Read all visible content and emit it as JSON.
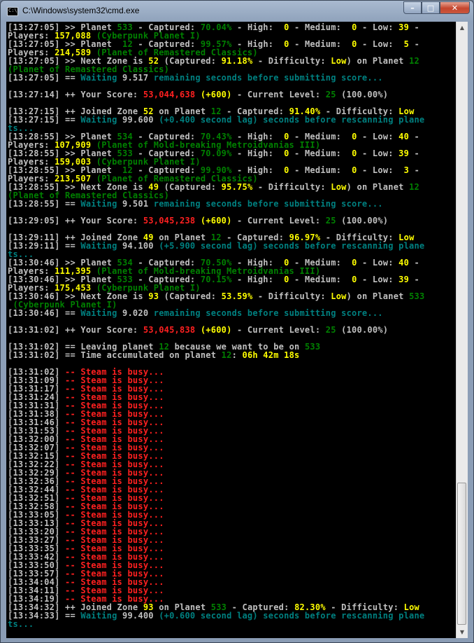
{
  "window": {
    "title": "C:\\Windows\\system32\\cmd.exe",
    "icon_text": "C:\\"
  },
  "controls": {
    "minimize": "–",
    "maximize": "□",
    "close": "✕"
  },
  "icons": {
    "scroll_up": "▲",
    "scroll_down": "▼"
  },
  "colors": {
    "white": "#c0c0c0",
    "yellow": "#ffff00",
    "green": "#008000",
    "cyan": "#008080",
    "red": "#ff2020"
  },
  "console_lines": [
    [
      [
        "w",
        "[13:27:05] >> Planet "
      ],
      [
        "g",
        "533"
      ],
      [
        "w",
        " - Captured: "
      ],
      [
        "g",
        "70.04%"
      ],
      [
        "w",
        " - High:  "
      ],
      [
        "y",
        "0"
      ],
      [
        "w",
        " - Medium:  "
      ],
      [
        "y",
        "0"
      ],
      [
        "w",
        " - Low: "
      ],
      [
        "y",
        "39"
      ],
      [
        "w",
        " -"
      ]
    ],
    [
      [
        "w",
        "Players: "
      ],
      [
        "y",
        "157,088"
      ],
      [
        "g",
        " (Cyberpunk Planet I)"
      ]
    ],
    [
      [
        "w",
        "[13:27:05] >> Planet  "
      ],
      [
        "g",
        "12"
      ],
      [
        "w",
        " - Captured: "
      ],
      [
        "g",
        "99.57%"
      ],
      [
        "w",
        " - High:  "
      ],
      [
        "y",
        "0"
      ],
      [
        "w",
        " - Medium:  "
      ],
      [
        "y",
        "0"
      ],
      [
        "w",
        " - Low:  "
      ],
      [
        "y",
        "5"
      ],
      [
        "w",
        " -"
      ]
    ],
    [
      [
        "w",
        "Players: "
      ],
      [
        "y",
        "214,589"
      ],
      [
        "g",
        " (Planet of Remastered Classics)"
      ]
    ],
    [
      [
        "w",
        "[13:27:05] >> Next Zone is "
      ],
      [
        "y",
        "52"
      ],
      [
        "w",
        " (Captured: "
      ],
      [
        "y",
        "91.18%"
      ],
      [
        "w",
        " - Difficulty: "
      ],
      [
        "y",
        "Low"
      ],
      [
        "w",
        ") on Planet "
      ],
      [
        "g",
        "12"
      ]
    ],
    [
      [
        "g",
        "(Planet of Remastered Classics)"
      ]
    ],
    [
      [
        "w",
        "[13:27:05] == "
      ],
      [
        "c",
        "Waiting "
      ],
      [
        "w",
        "9.517"
      ],
      [
        "c",
        " remaining seconds before submitting score..."
      ]
    ],
    [
      [
        "w",
        ""
      ]
    ],
    [
      [
        "w",
        "[13:27:14] ++ Your Score: "
      ],
      [
        "r",
        "53,044,638"
      ],
      [
        "y",
        " (+600)"
      ],
      [
        "w",
        " - Current Level: "
      ],
      [
        "g",
        "25"
      ],
      [
        "w",
        " (100.00%)"
      ]
    ],
    [
      [
        "w",
        ""
      ]
    ],
    [
      [
        "w",
        "[13:27:15] ++ Joined Zone "
      ],
      [
        "y",
        "52"
      ],
      [
        "w",
        " on Planet "
      ],
      [
        "g",
        "12"
      ],
      [
        "w",
        " - Captured: "
      ],
      [
        "y",
        "91.40%"
      ],
      [
        "w",
        " - Difficulty: "
      ],
      [
        "y",
        "Low"
      ]
    ],
    [
      [
        "w",
        "[13:27:15] == "
      ],
      [
        "c",
        "Waiting "
      ],
      [
        "w",
        "99.600"
      ],
      [
        "c",
        " (+0.400 second lag) seconds before rescanning plane"
      ]
    ],
    [
      [
        "c",
        "ts..."
      ]
    ],
    [
      [
        "w",
        "[13:28:55] >> Planet "
      ],
      [
        "g",
        "534"
      ],
      [
        "w",
        " - Captured: "
      ],
      [
        "g",
        "70.43%"
      ],
      [
        "w",
        " - High:  "
      ],
      [
        "y",
        "0"
      ],
      [
        "w",
        " - Medium:  "
      ],
      [
        "y",
        "0"
      ],
      [
        "w",
        " - Low: "
      ],
      [
        "y",
        "40"
      ],
      [
        "w",
        " -"
      ]
    ],
    [
      [
        "w",
        "Players: "
      ],
      [
        "y",
        "107,909"
      ],
      [
        "g",
        " (Planet of Mold-breaking Metroidvanias III)"
      ]
    ],
    [
      [
        "w",
        "[13:28:55] >> Planet "
      ],
      [
        "g",
        "533"
      ],
      [
        "w",
        " - Captured: "
      ],
      [
        "g",
        "70.09%"
      ],
      [
        "w",
        " - High:  "
      ],
      [
        "y",
        "0"
      ],
      [
        "w",
        " - Medium:  "
      ],
      [
        "y",
        "0"
      ],
      [
        "w",
        " - Low: "
      ],
      [
        "y",
        "39"
      ],
      [
        "w",
        " -"
      ]
    ],
    [
      [
        "w",
        "Players: "
      ],
      [
        "y",
        "159,003"
      ],
      [
        "g",
        " (Cyberpunk Planet I)"
      ]
    ],
    [
      [
        "w",
        "[13:28:55] >> Planet  "
      ],
      [
        "g",
        "12"
      ],
      [
        "w",
        " - Captured: "
      ],
      [
        "g",
        "99.90%"
      ],
      [
        "w",
        " - High:  "
      ],
      [
        "y",
        "0"
      ],
      [
        "w",
        " - Medium:  "
      ],
      [
        "y",
        "0"
      ],
      [
        "w",
        " - Low:  "
      ],
      [
        "y",
        "3"
      ],
      [
        "w",
        " -"
      ]
    ],
    [
      [
        "w",
        "Players: "
      ],
      [
        "y",
        "213,507"
      ],
      [
        "g",
        " (Planet of Remastered Classics)"
      ]
    ],
    [
      [
        "w",
        "[13:28:55] >> Next Zone is "
      ],
      [
        "y",
        "49"
      ],
      [
        "w",
        " (Captured: "
      ],
      [
        "y",
        "95.75%"
      ],
      [
        "w",
        " - Difficulty: "
      ],
      [
        "y",
        "Low"
      ],
      [
        "w",
        ") on Planet "
      ],
      [
        "g",
        "12"
      ]
    ],
    [
      [
        "g",
        "(Planet of Remastered Classics)"
      ]
    ],
    [
      [
        "w",
        "[13:28:55] == "
      ],
      [
        "c",
        "Waiting "
      ],
      [
        "w",
        "9.501"
      ],
      [
        "c",
        " remaining seconds before submitting score..."
      ]
    ],
    [
      [
        "w",
        ""
      ]
    ],
    [
      [
        "w",
        "[13:29:05] ++ Your Score: "
      ],
      [
        "r",
        "53,045,238"
      ],
      [
        "y",
        " (+600)"
      ],
      [
        "w",
        " - Current Level: "
      ],
      [
        "g",
        "25"
      ],
      [
        "w",
        " (100.00%)"
      ]
    ],
    [
      [
        "w",
        ""
      ]
    ],
    [
      [
        "w",
        "[13:29:11] ++ Joined Zone "
      ],
      [
        "y",
        "49"
      ],
      [
        "w",
        " on Planet "
      ],
      [
        "g",
        "12"
      ],
      [
        "w",
        " - Captured: "
      ],
      [
        "y",
        "96.97%"
      ],
      [
        "w",
        " - Difficulty: "
      ],
      [
        "y",
        "Low"
      ]
    ],
    [
      [
        "w",
        "[13:29:11] == "
      ],
      [
        "c",
        "Waiting "
      ],
      [
        "w",
        "94.100"
      ],
      [
        "c",
        " (+5.900 second lag) seconds before rescanning plane"
      ]
    ],
    [
      [
        "c",
        "ts..."
      ]
    ],
    [
      [
        "w",
        "[13:30:46] >> Planet "
      ],
      [
        "g",
        "534"
      ],
      [
        "w",
        " - Captured: "
      ],
      [
        "g",
        "70.50%"
      ],
      [
        "w",
        " - High:  "
      ],
      [
        "y",
        "0"
      ],
      [
        "w",
        " - Medium:  "
      ],
      [
        "y",
        "0"
      ],
      [
        "w",
        " - Low: "
      ],
      [
        "y",
        "40"
      ],
      [
        "w",
        " -"
      ]
    ],
    [
      [
        "w",
        "Players: "
      ],
      [
        "y",
        "111,395"
      ],
      [
        "g",
        " (Planet of Mold-breaking Metroidvanias III)"
      ]
    ],
    [
      [
        "w",
        "[13:30:46] >> Planet "
      ],
      [
        "g",
        "533"
      ],
      [
        "w",
        " - Captured: "
      ],
      [
        "g",
        "70.15%"
      ],
      [
        "w",
        " - High:  "
      ],
      [
        "y",
        "0"
      ],
      [
        "w",
        " - Medium:  "
      ],
      [
        "y",
        "0"
      ],
      [
        "w",
        " - Low: "
      ],
      [
        "y",
        "39"
      ],
      [
        "w",
        " -"
      ]
    ],
    [
      [
        "w",
        "Players: "
      ],
      [
        "y",
        "175,453"
      ],
      [
        "g",
        " (Cyberpunk Planet I)"
      ]
    ],
    [
      [
        "w",
        "[13:30:46] >> Next Zone is "
      ],
      [
        "y",
        "93"
      ],
      [
        "w",
        " (Captured: "
      ],
      [
        "y",
        "53.59%"
      ],
      [
        "w",
        " - Difficulty: "
      ],
      [
        "y",
        "Low"
      ],
      [
        "w",
        ") on Planet "
      ],
      [
        "g",
        "533"
      ]
    ],
    [
      [
        "g",
        " (Cyberpunk Planet I)"
      ]
    ],
    [
      [
        "w",
        "[13:30:46] == "
      ],
      [
        "c",
        "Waiting "
      ],
      [
        "w",
        "9.020"
      ],
      [
        "c",
        " remaining seconds before submitting score..."
      ]
    ],
    [
      [
        "w",
        ""
      ]
    ],
    [
      [
        "w",
        "[13:31:02] ++ Your Score: "
      ],
      [
        "r",
        "53,045,838"
      ],
      [
        "y",
        " (+600)"
      ],
      [
        "w",
        " - Current Level: "
      ],
      [
        "g",
        "25"
      ],
      [
        "w",
        " (100.00%)"
      ]
    ],
    [
      [
        "w",
        ""
      ]
    ],
    [
      [
        "w",
        "[13:31:02] == Leaving planet "
      ],
      [
        "g",
        "12"
      ],
      [
        "w",
        " because we want to be on "
      ],
      [
        "g",
        "533"
      ]
    ],
    [
      [
        "w",
        "[13:31:02] == Time accumulated on planet "
      ],
      [
        "g",
        "12"
      ],
      [
        "w",
        ": "
      ],
      [
        "y",
        "06h 42m 18s"
      ]
    ],
    [
      [
        "w",
        ""
      ]
    ],
    [
      [
        "w",
        "[13:31:02] "
      ],
      [
        "r",
        "-- Steam is busy..."
      ]
    ],
    [
      [
        "w",
        "[13:31:09] "
      ],
      [
        "r",
        "-- Steam is busy..."
      ]
    ],
    [
      [
        "w",
        "[13:31:17] "
      ],
      [
        "r",
        "-- Steam is busy..."
      ]
    ],
    [
      [
        "w",
        "[13:31:24] "
      ],
      [
        "r",
        "-- Steam is busy..."
      ]
    ],
    [
      [
        "w",
        "[13:31:31] "
      ],
      [
        "r",
        "-- Steam is busy..."
      ]
    ],
    [
      [
        "w",
        "[13:31:38] "
      ],
      [
        "r",
        "-- Steam is busy..."
      ]
    ],
    [
      [
        "w",
        "[13:31:46] "
      ],
      [
        "r",
        "-- Steam is busy..."
      ]
    ],
    [
      [
        "w",
        "[13:31:53] "
      ],
      [
        "r",
        "-- Steam is busy..."
      ]
    ],
    [
      [
        "w",
        "[13:32:00] "
      ],
      [
        "r",
        "-- Steam is busy..."
      ]
    ],
    [
      [
        "w",
        "[13:32:07] "
      ],
      [
        "r",
        "-- Steam is busy..."
      ]
    ],
    [
      [
        "w",
        "[13:32:15] "
      ],
      [
        "r",
        "-- Steam is busy..."
      ]
    ],
    [
      [
        "w",
        "[13:32:22] "
      ],
      [
        "r",
        "-- Steam is busy..."
      ]
    ],
    [
      [
        "w",
        "[13:32:29] "
      ],
      [
        "r",
        "-- Steam is busy..."
      ]
    ],
    [
      [
        "w",
        "[13:32:36] "
      ],
      [
        "r",
        "-- Steam is busy..."
      ]
    ],
    [
      [
        "w",
        "[13:32:44] "
      ],
      [
        "r",
        "-- Steam is busy..."
      ]
    ],
    [
      [
        "w",
        "[13:32:51] "
      ],
      [
        "r",
        "-- Steam is busy..."
      ]
    ],
    [
      [
        "w",
        "[13:32:58] "
      ],
      [
        "r",
        "-- Steam is busy..."
      ]
    ],
    [
      [
        "w",
        "[13:33:05] "
      ],
      [
        "r",
        "-- Steam is busy..."
      ]
    ],
    [
      [
        "w",
        "[13:33:13] "
      ],
      [
        "r",
        "-- Steam is busy..."
      ]
    ],
    [
      [
        "w",
        "[13:33:20] "
      ],
      [
        "r",
        "-- Steam is busy..."
      ]
    ],
    [
      [
        "w",
        "[13:33:27] "
      ],
      [
        "r",
        "-- Steam is busy..."
      ]
    ],
    [
      [
        "w",
        "[13:33:35] "
      ],
      [
        "r",
        "-- Steam is busy..."
      ]
    ],
    [
      [
        "w",
        "[13:33:42] "
      ],
      [
        "r",
        "-- Steam is busy..."
      ]
    ],
    [
      [
        "w",
        "[13:33:50] "
      ],
      [
        "r",
        "-- Steam is busy..."
      ]
    ],
    [
      [
        "w",
        "[13:33:57] "
      ],
      [
        "r",
        "-- Steam is busy..."
      ]
    ],
    [
      [
        "w",
        "[13:34:04] "
      ],
      [
        "r",
        "-- Steam is busy..."
      ]
    ],
    [
      [
        "w",
        "[13:34:11] "
      ],
      [
        "r",
        "-- Steam is busy..."
      ]
    ],
    [
      [
        "w",
        "[13:34:19] "
      ],
      [
        "r",
        "-- Steam is busy..."
      ]
    ],
    [
      [
        "w",
        "[13:34:32] ++ Joined Zone "
      ],
      [
        "y",
        "93"
      ],
      [
        "w",
        " on Planet "
      ],
      [
        "g",
        "533"
      ],
      [
        "w",
        " - Captured: "
      ],
      [
        "y",
        "82.30%"
      ],
      [
        "w",
        " - Difficulty: "
      ],
      [
        "y",
        "Low"
      ]
    ],
    [
      [
        "w",
        "[13:34:33] == "
      ],
      [
        "c",
        "Waiting "
      ],
      [
        "w",
        "99.400"
      ],
      [
        "c",
        " (+0.600 second lag) seconds before rescanning plane"
      ]
    ],
    [
      [
        "c",
        "ts..."
      ]
    ]
  ]
}
